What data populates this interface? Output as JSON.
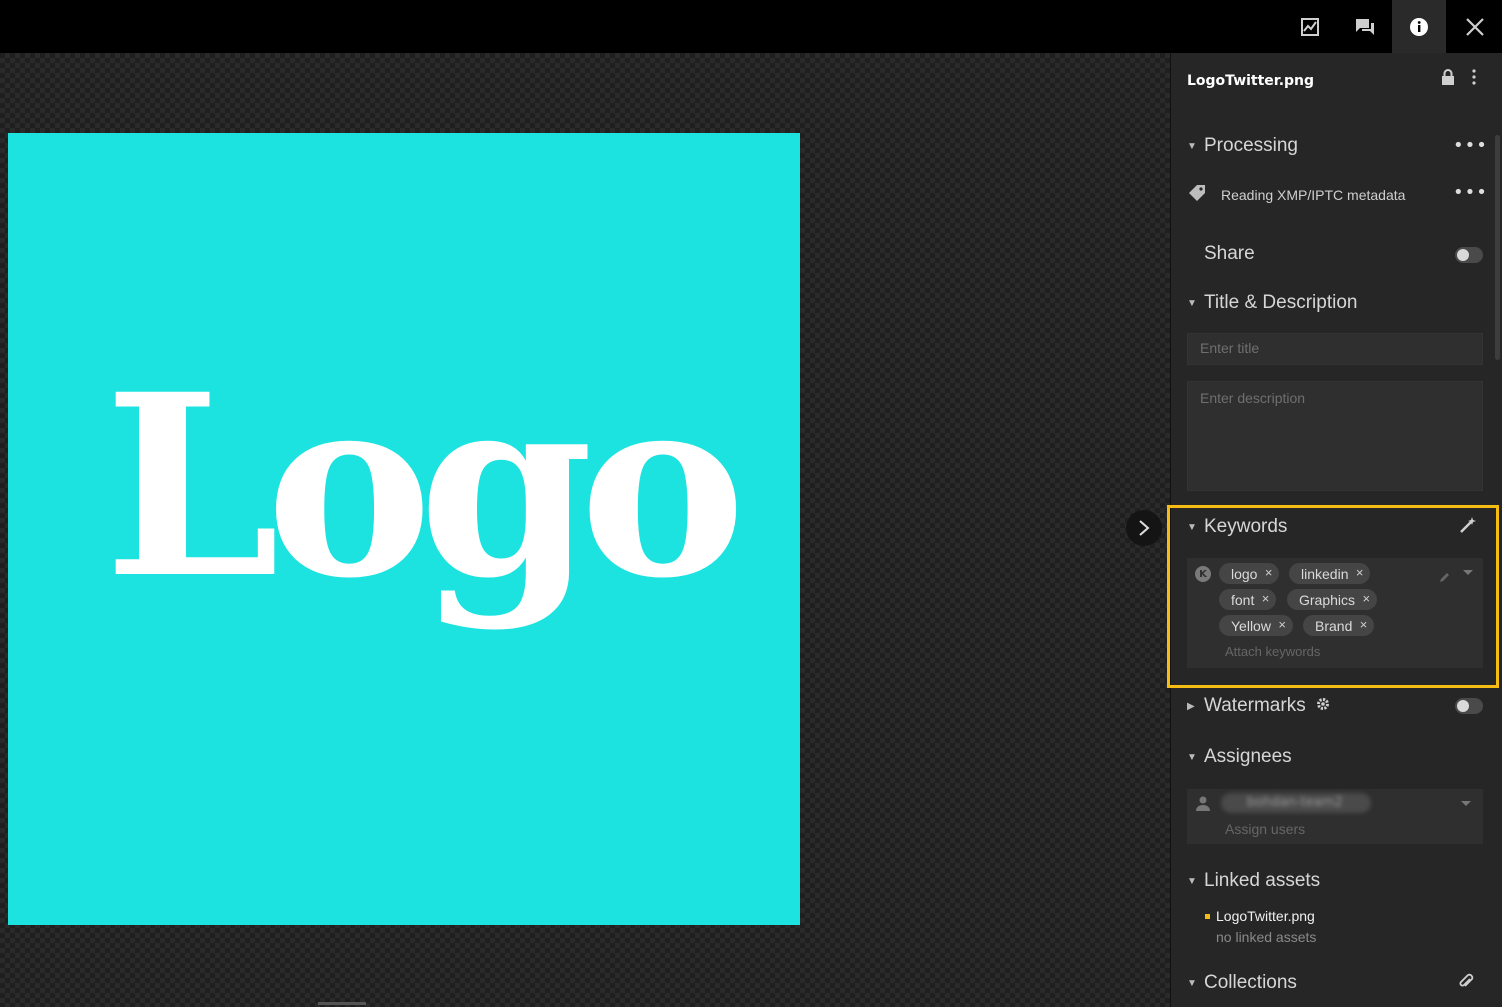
{
  "topbar": {
    "icons": [
      "chart-icon",
      "comments-icon",
      "info-icon",
      "close-icon"
    ]
  },
  "preview": {
    "image_text": "Logo",
    "image_bg": "#1ce3e0"
  },
  "panel": {
    "file_name": "LogoTwitter.png",
    "processing": {
      "title": "Processing",
      "item": "Reading XMP/IPTC metadata"
    },
    "share": {
      "title": "Share",
      "enabled": false
    },
    "title_description": {
      "title": "Title & Description",
      "title_placeholder": "Enter title",
      "description_placeholder": "Enter description"
    },
    "keywords": {
      "title": "Keywords",
      "badge": "K",
      "chips": [
        "logo",
        "linkedin",
        "font",
        "Graphics",
        "Yellow",
        "Brand"
      ],
      "placeholder": "Attach keywords"
    },
    "watermarks": {
      "title": "Watermarks",
      "enabled": false
    },
    "assignees": {
      "title": "Assignees",
      "assignee_blurred": "bohdan-team2",
      "placeholder": "Assign users"
    },
    "linked_assets": {
      "title": "Linked assets",
      "asset_name": "LogoTwitter.png",
      "status": "no linked assets"
    },
    "collections": {
      "title": "Collections"
    }
  },
  "colors": {
    "highlight": "#f5bd14",
    "accent_dot": "#f5bd14",
    "panel_bg": "#262626"
  }
}
